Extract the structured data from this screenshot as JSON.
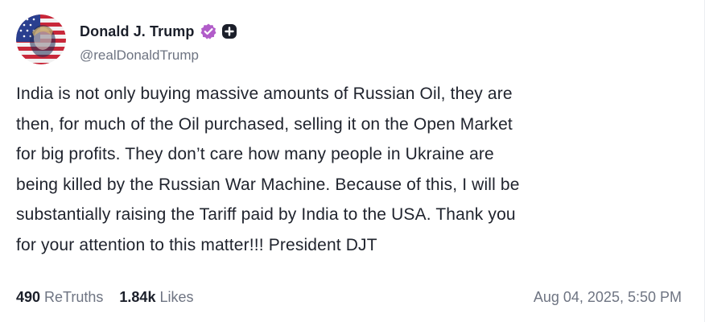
{
  "author": {
    "display_name": "Donald J. Trump",
    "handle": "@realDonaldTrump",
    "avatar_icon": "flag-portrait-avatar",
    "verified_icon": "verified-badge-icon",
    "plus_icon": "plus-badge-icon",
    "verified_color": "#b15cc9"
  },
  "post": {
    "text": "India is not only buying massive amounts of Russian Oil, they are\nthen, for much of the Oil purchased, selling it on the Open Market\nfor big profits. They don’t care how many people in Ukraine are\nbeing killed by the Russian War Machine. Because of this, I will be\nsubstantially raising the Tariff paid by India to the USA. Thank you\nfor your attention to this matter!!! President DJT"
  },
  "stats": {
    "retruths_count": "490",
    "retruths_label": "ReTruths",
    "likes_count": "1.84k",
    "likes_label": "Likes"
  },
  "timestamp": "Aug 04, 2025, 5:50 PM"
}
